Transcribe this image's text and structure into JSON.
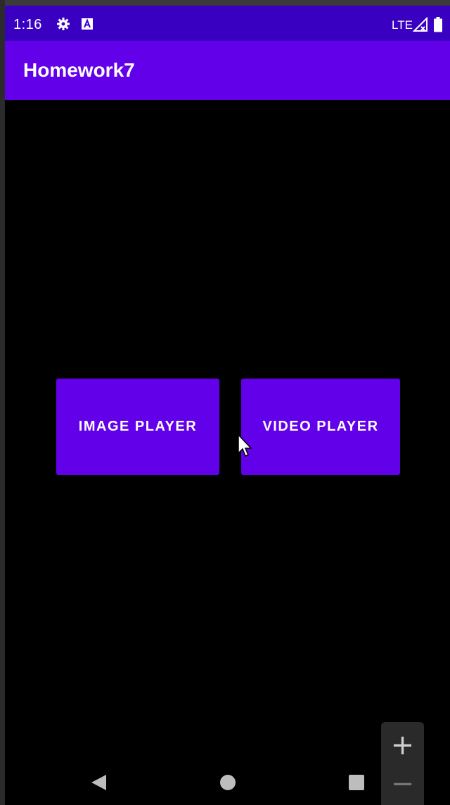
{
  "status_bar": {
    "time": "1:16",
    "icons": [
      "gear-icon",
      "font-a-icon",
      "lte-icon",
      "signal-icon",
      "battery-icon"
    ],
    "lte_label": "LTE"
  },
  "app_bar": {
    "title": "Homework7"
  },
  "main": {
    "image_player_label": "IMAGE PLAYER",
    "video_player_label": "VIDEO PLAYER"
  },
  "nav_bar": {
    "icons": [
      "back-icon",
      "home-icon",
      "recents-icon"
    ]
  },
  "zoom_control": {
    "plus_label": "+",
    "minus_label": "−"
  },
  "colors": {
    "primary": "#6200ea",
    "status_bar": "#3a00c2",
    "background": "#000000"
  }
}
